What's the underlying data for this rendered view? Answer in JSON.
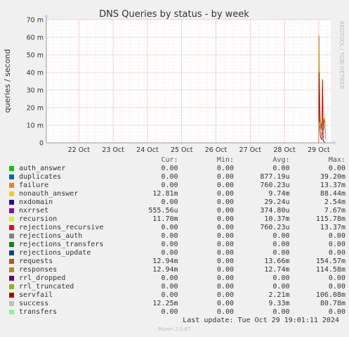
{
  "chart_data": {
    "type": "line",
    "title": "DNS Queries by status - by week",
    "ylabel": "queries / second",
    "ylim": [
      0,
      70
    ],
    "yticks": [
      "0",
      "10 m",
      "20 m",
      "30 m",
      "40 m",
      "50 m",
      "60 m",
      "70 m"
    ],
    "ytick_values": [
      0,
      10,
      20,
      30,
      40,
      50,
      60,
      70
    ],
    "xticks": [
      "22 Oct",
      "23 Oct",
      "24 Oct",
      "25 Oct",
      "26 Oct",
      "27 Oct",
      "28 Oct",
      "29 Oct"
    ],
    "x_range_days": [
      21.05,
      29.35
    ],
    "grid": true,
    "series": [
      {
        "name": "requests",
        "color": "#c86400",
        "points": [
          [
            29.0,
            0
          ],
          [
            29.005,
            61
          ],
          [
            29.02,
            35
          ],
          [
            29.04,
            15
          ],
          [
            29.06,
            9
          ],
          [
            29.08,
            11
          ],
          [
            29.1,
            5
          ],
          [
            29.12,
            8
          ],
          [
            29.16,
            14
          ],
          [
            29.2,
            4
          ]
        ]
      },
      {
        "name": "responses",
        "color": "#b4a000",
        "points": [
          [
            29.0,
            0
          ],
          [
            29.005,
            55
          ],
          [
            29.02,
            30
          ],
          [
            29.04,
            13
          ],
          [
            29.06,
            8
          ],
          [
            29.08,
            10
          ],
          [
            29.1,
            5
          ],
          [
            29.14,
            7
          ],
          [
            29.18,
            13
          ],
          [
            29.2,
            3
          ]
        ]
      },
      {
        "name": "servfail",
        "color": "#c00000",
        "points": [
          [
            29.0,
            0
          ],
          [
            29.008,
            40
          ],
          [
            29.03,
            10
          ],
          [
            29.05,
            3
          ],
          [
            29.09,
            2
          ],
          [
            29.11,
            36
          ],
          [
            29.13,
            1
          ],
          [
            29.2,
            0
          ]
        ]
      },
      {
        "name": "success",
        "color": "#aaaaaa",
        "points": [
          [
            29.0,
            0
          ],
          [
            29.01,
            12
          ],
          [
            29.04,
            10
          ],
          [
            29.07,
            9
          ],
          [
            29.1,
            6
          ],
          [
            29.14,
            7
          ],
          [
            29.18,
            11
          ],
          [
            29.2,
            2
          ]
        ]
      }
    ]
  },
  "watermark": "RRDTOOL / TOBI OETIKER",
  "legend": {
    "headers": [
      "Cur:",
      "Min:",
      "Avg:",
      "Max:"
    ],
    "rows": [
      {
        "name": "auth_answer",
        "color": "#00cc00",
        "cur": "0.00",
        "min": "0.00",
        "avg": "0.00",
        "max": "0.00"
      },
      {
        "name": "duplicates",
        "color": "#0066b3",
        "cur": "0.00",
        "min": "0.00",
        "avg": "877.19u",
        "max": "39.20m"
      },
      {
        "name": "failure",
        "color": "#ff8000",
        "cur": "0.00",
        "min": "0.00",
        "avg": "760.23u",
        "max": "13.37m"
      },
      {
        "name": "nonauth_answer",
        "color": "#ffcc00",
        "cur": "12.81m",
        "min": "0.00",
        "avg": "9.74m",
        "max": "88.44m"
      },
      {
        "name": "nxdomain",
        "color": "#330099",
        "cur": "0.00",
        "min": "0.00",
        "avg": "29.24u",
        "max": "2.54m"
      },
      {
        "name": "nxrrset",
        "color": "#990099",
        "cur": "555.56u",
        "min": "0.00",
        "avg": "374.80u",
        "max": "7.67m"
      },
      {
        "name": "recursion",
        "color": "#ccff00",
        "cur": "11.70m",
        "min": "0.00",
        "avg": "10.37m",
        "max": "115.78m"
      },
      {
        "name": "rejections_recursive",
        "color": "#ff0000",
        "cur": "0.00",
        "min": "0.00",
        "avg": "760.23u",
        "max": "13.37m"
      },
      {
        "name": "rejections_auth",
        "color": "#808080",
        "cur": "0.00",
        "min": "0.00",
        "avg": "0.00",
        "max": "0.00"
      },
      {
        "name": "rejections_transfers",
        "color": "#008f00",
        "cur": "0.00",
        "min": "0.00",
        "avg": "0.00",
        "max": "0.00"
      },
      {
        "name": "rejections_update",
        "color": "#00487d",
        "cur": "0.00",
        "min": "0.00",
        "avg": "0.00",
        "max": "0.00"
      },
      {
        "name": "requests",
        "color": "#b35a00",
        "cur": "12.94m",
        "min": "0.00",
        "avg": "13.66m",
        "max": "154.57m"
      },
      {
        "name": "responses",
        "color": "#b38f00",
        "cur": "12.94m",
        "min": "0.00",
        "avg": "12.74m",
        "max": "114.58m"
      },
      {
        "name": "rrl_dropped",
        "color": "#6b006b",
        "cur": "0.00",
        "min": "0.00",
        "avg": "0.00",
        "max": "0.00"
      },
      {
        "name": "rrl_truncated",
        "color": "#8fb300",
        "cur": "0.00",
        "min": "0.00",
        "avg": "0.00",
        "max": "0.00"
      },
      {
        "name": "servfail",
        "color": "#b30000",
        "cur": "0.00",
        "min": "0.00",
        "avg": "2.21m",
        "max": "106.08m"
      },
      {
        "name": "success",
        "color": "#bebebe",
        "cur": "12.25m",
        "min": "0.00",
        "avg": "9.33m",
        "max": "80.78m"
      },
      {
        "name": "transfers",
        "color": "#80ff80",
        "cur": "0.00",
        "min": "0.00",
        "avg": "0.00",
        "max": "0.00"
      }
    ]
  },
  "footer": {
    "last_update": "Last update: Tue Oct 29 19:01:11 2024",
    "munin": "Munin 2.0.67"
  }
}
